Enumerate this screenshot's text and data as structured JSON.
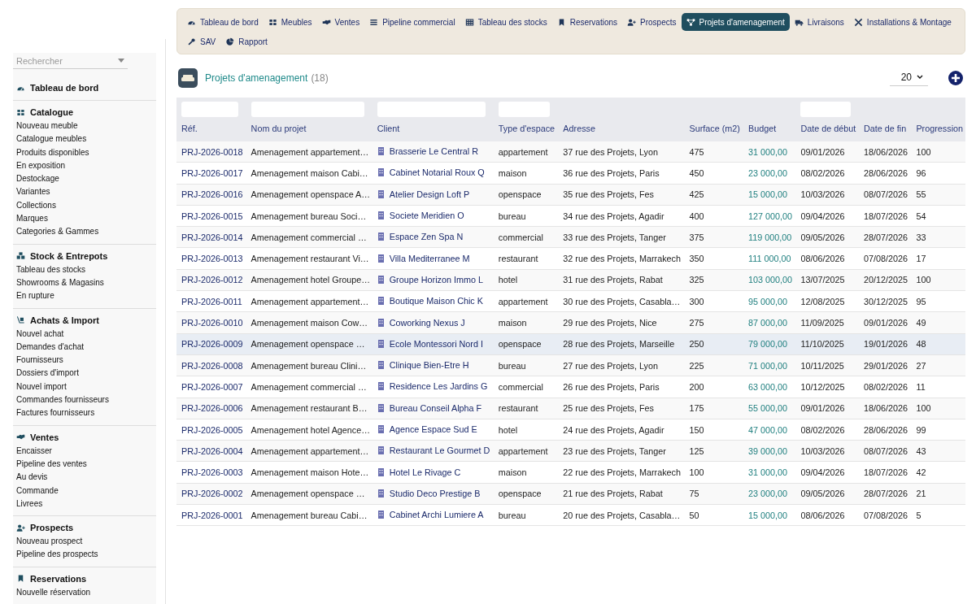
{
  "sidebar": {
    "search": {
      "placeholder": "Rechercher"
    },
    "sections": [
      {
        "title": "Tableau de bord"
      },
      {
        "title": "Catalogue",
        "items": [
          "Nouveau meuble",
          "Catalogue meubles",
          "Produits disponibles",
          "En exposition",
          "Destockage",
          "Variantes",
          "Collections",
          "Marques",
          "Categories & Gammes"
        ]
      },
      {
        "title": "Stock & Entrepots",
        "items": [
          "Tableau des stocks",
          "Showrooms & Magasins",
          "En rupture"
        ]
      },
      {
        "title": "Achats & Import",
        "items": [
          "Nouvel achat",
          "Demandes d'achat",
          "Fournisseurs",
          "Dossiers d'import",
          "Nouvel import",
          "Commandes fournisseurs",
          "Factures fournisseurs"
        ]
      },
      {
        "title": "Ventes",
        "items": [
          "Encaisser",
          "Pipeline des ventes",
          "Au devis",
          "Commande",
          "Livrees"
        ]
      },
      {
        "title": "Prospects",
        "items": [
          "Nouveau prospect",
          "Pipeline des prospects"
        ]
      },
      {
        "title": "Reservations",
        "items": [
          "Nouvelle réservation"
        ]
      }
    ]
  },
  "tabs": [
    {
      "label": "Tableau de bord",
      "selected": false
    },
    {
      "label": "Meubles",
      "selected": false
    },
    {
      "label": "Ventes",
      "selected": false
    },
    {
      "label": "Pipeline commercial",
      "selected": false
    },
    {
      "label": "Tableau des stocks",
      "selected": false
    },
    {
      "label": "Reservations",
      "selected": false
    },
    {
      "label": "Prospects",
      "selected": false
    },
    {
      "label": "Projets d'amenagement",
      "selected": true
    },
    {
      "label": "Livraisons",
      "selected": false
    },
    {
      "label": "Installations & Montage",
      "selected": false
    },
    {
      "label": "SAV",
      "selected": false
    },
    {
      "label": "Rapport",
      "selected": false
    }
  ],
  "page": {
    "title": "Projets d'amenagement",
    "count": "(18)",
    "page_size": "20"
  },
  "table": {
    "columns": [
      {
        "label": "Réf.",
        "filter": true
      },
      {
        "label": "Nom du projet",
        "filter": true
      },
      {
        "label": "Client",
        "filter": true
      },
      {
        "label": "Type d'espace",
        "filter": true
      },
      {
        "label": "Adresse",
        "filter": false
      },
      {
        "label": "Surface (m2)",
        "filter": false
      },
      {
        "label": "Budget",
        "filter": false
      },
      {
        "label": "Date de début",
        "filter": true
      },
      {
        "label": "Date de fin",
        "filter": false
      },
      {
        "label": "Progression",
        "filter": false
      }
    ],
    "rows": [
      {
        "selected": false,
        "cells": [
          "PRJ-2026-0018",
          "Amenagement appartement…",
          "Brasserie Le Central R",
          "appartement",
          "37 rue des Projets, Lyon",
          "475",
          "31 000,00",
          "09/01/2026",
          "18/06/2026",
          "100"
        ]
      },
      {
        "selected": false,
        "cells": [
          "PRJ-2026-0017",
          "Amenagement maison Cabi…",
          "Cabinet Notarial Roux Q",
          "maison",
          "36 rue des Projets, Paris",
          "450",
          "23 000,00",
          "08/02/2026",
          "28/06/2026",
          "96"
        ]
      },
      {
        "selected": false,
        "cells": [
          "PRJ-2026-0016",
          "Amenagement openspace A…",
          "Atelier Design Loft P",
          "openspace",
          "35 rue des Projets, Fes",
          "425",
          "15 000,00",
          "10/03/2026",
          "08/07/2026",
          "55"
        ]
      },
      {
        "selected": false,
        "cells": [
          "PRJ-2026-0015",
          "Amenagement bureau Soci…",
          "Societe Meridien O",
          "bureau",
          "34 rue des Projets, Agadir",
          "400",
          "127 000,00",
          "09/04/2026",
          "18/07/2026",
          "54"
        ]
      },
      {
        "selected": false,
        "cells": [
          "PRJ-2026-0014",
          "Amenagement commercial …",
          "Espace Zen Spa N",
          "commercial",
          "33 rue des Projets, Tanger",
          "375",
          "119 000,00",
          "09/05/2026",
          "28/07/2026",
          "33"
        ]
      },
      {
        "selected": false,
        "cells": [
          "PRJ-2026-0013",
          "Amenagement restaurant Vi…",
          "Villa Mediterranee M",
          "restaurant",
          "32 rue des Projets, Marrakech",
          "350",
          "111 000,00",
          "08/06/2026",
          "07/08/2026",
          "17"
        ]
      },
      {
        "selected": false,
        "cells": [
          "PRJ-2026-0012",
          "Amenagement hotel Groupe…",
          "Groupe Horizon Immo L",
          "hotel",
          "31 rue des Projets, Rabat",
          "325",
          "103 000,00",
          "13/07/2025",
          "20/12/2025",
          "100"
        ]
      },
      {
        "selected": false,
        "cells": [
          "PRJ-2026-0011",
          "Amenagement appartement…",
          "Boutique Maison Chic K",
          "appartement",
          "30 rue des Projets, Casabla…",
          "300",
          "95 000,00",
          "12/08/2025",
          "30/12/2025",
          "95"
        ]
      },
      {
        "selected": false,
        "cells": [
          "PRJ-2026-0010",
          "Amenagement maison Cow…",
          "Coworking Nexus J",
          "maison",
          "29 rue des Projets, Nice",
          "275",
          "87 000,00",
          "11/09/2025",
          "09/01/2026",
          "49"
        ]
      },
      {
        "selected": true,
        "cells": [
          "PRJ-2026-0009",
          "Amenagement openspace …",
          "Ecole Montessori Nord I",
          "openspace",
          "28 rue des Projets, Marseille",
          "250",
          "79 000,00",
          "11/10/2025",
          "19/01/2026",
          "48"
        ]
      },
      {
        "selected": false,
        "cells": [
          "PRJ-2026-0008",
          "Amenagement bureau Clini…",
          "Clinique Bien-Etre H",
          "bureau",
          "27 rue des Projets, Lyon",
          "225",
          "71 000,00",
          "10/11/2025",
          "29/01/2026",
          "27"
        ]
      },
      {
        "selected": false,
        "cells": [
          "PRJ-2026-0007",
          "Amenagement commercial …",
          "Residence Les Jardins G",
          "commercial",
          "26 rue des Projets, Paris",
          "200",
          "63 000,00",
          "10/12/2025",
          "08/02/2026",
          "11"
        ]
      },
      {
        "selected": false,
        "cells": [
          "PRJ-2026-0006",
          "Amenagement restaurant B…",
          "Bureau Conseil Alpha F",
          "restaurant",
          "25 rue des Projets, Fes",
          "175",
          "55 000,00",
          "09/01/2026",
          "18/06/2026",
          "100"
        ]
      },
      {
        "selected": false,
        "cells": [
          "PRJ-2026-0005",
          "Amenagement hotel Agence…",
          "Agence Espace Sud E",
          "hotel",
          "24 rue des Projets, Agadir",
          "150",
          "47 000,00",
          "08/02/2026",
          "28/06/2026",
          "99"
        ]
      },
      {
        "selected": false,
        "cells": [
          "PRJ-2026-0004",
          "Amenagement appartement…",
          "Restaurant Le Gourmet D",
          "appartement",
          "23 rue des Projets, Tanger",
          "125",
          "39 000,00",
          "10/03/2026",
          "08/07/2026",
          "43"
        ]
      },
      {
        "selected": false,
        "cells": [
          "PRJ-2026-0003",
          "Amenagement maison Hote…",
          "Hotel Le Rivage C",
          "maison",
          "22 rue des Projets, Marrakech",
          "100",
          "31 000,00",
          "09/04/2026",
          "18/07/2026",
          "42"
        ]
      },
      {
        "selected": false,
        "cells": [
          "PRJ-2026-0002",
          "Amenagement openspace …",
          "Studio Deco Prestige B",
          "openspace",
          "21 rue des Projets, Rabat",
          "75",
          "23 000,00",
          "09/05/2026",
          "28/07/2026",
          "21"
        ]
      },
      {
        "selected": false,
        "cells": [
          "PRJ-2026-0001",
          "Amenagement bureau Cabi…",
          "Cabinet Archi Lumiere A",
          "bureau",
          "20 rue des Projets, Casabla…",
          "50",
          "15 000,00",
          "08/06/2026",
          "07/08/2026",
          "5"
        ]
      }
    ]
  }
}
